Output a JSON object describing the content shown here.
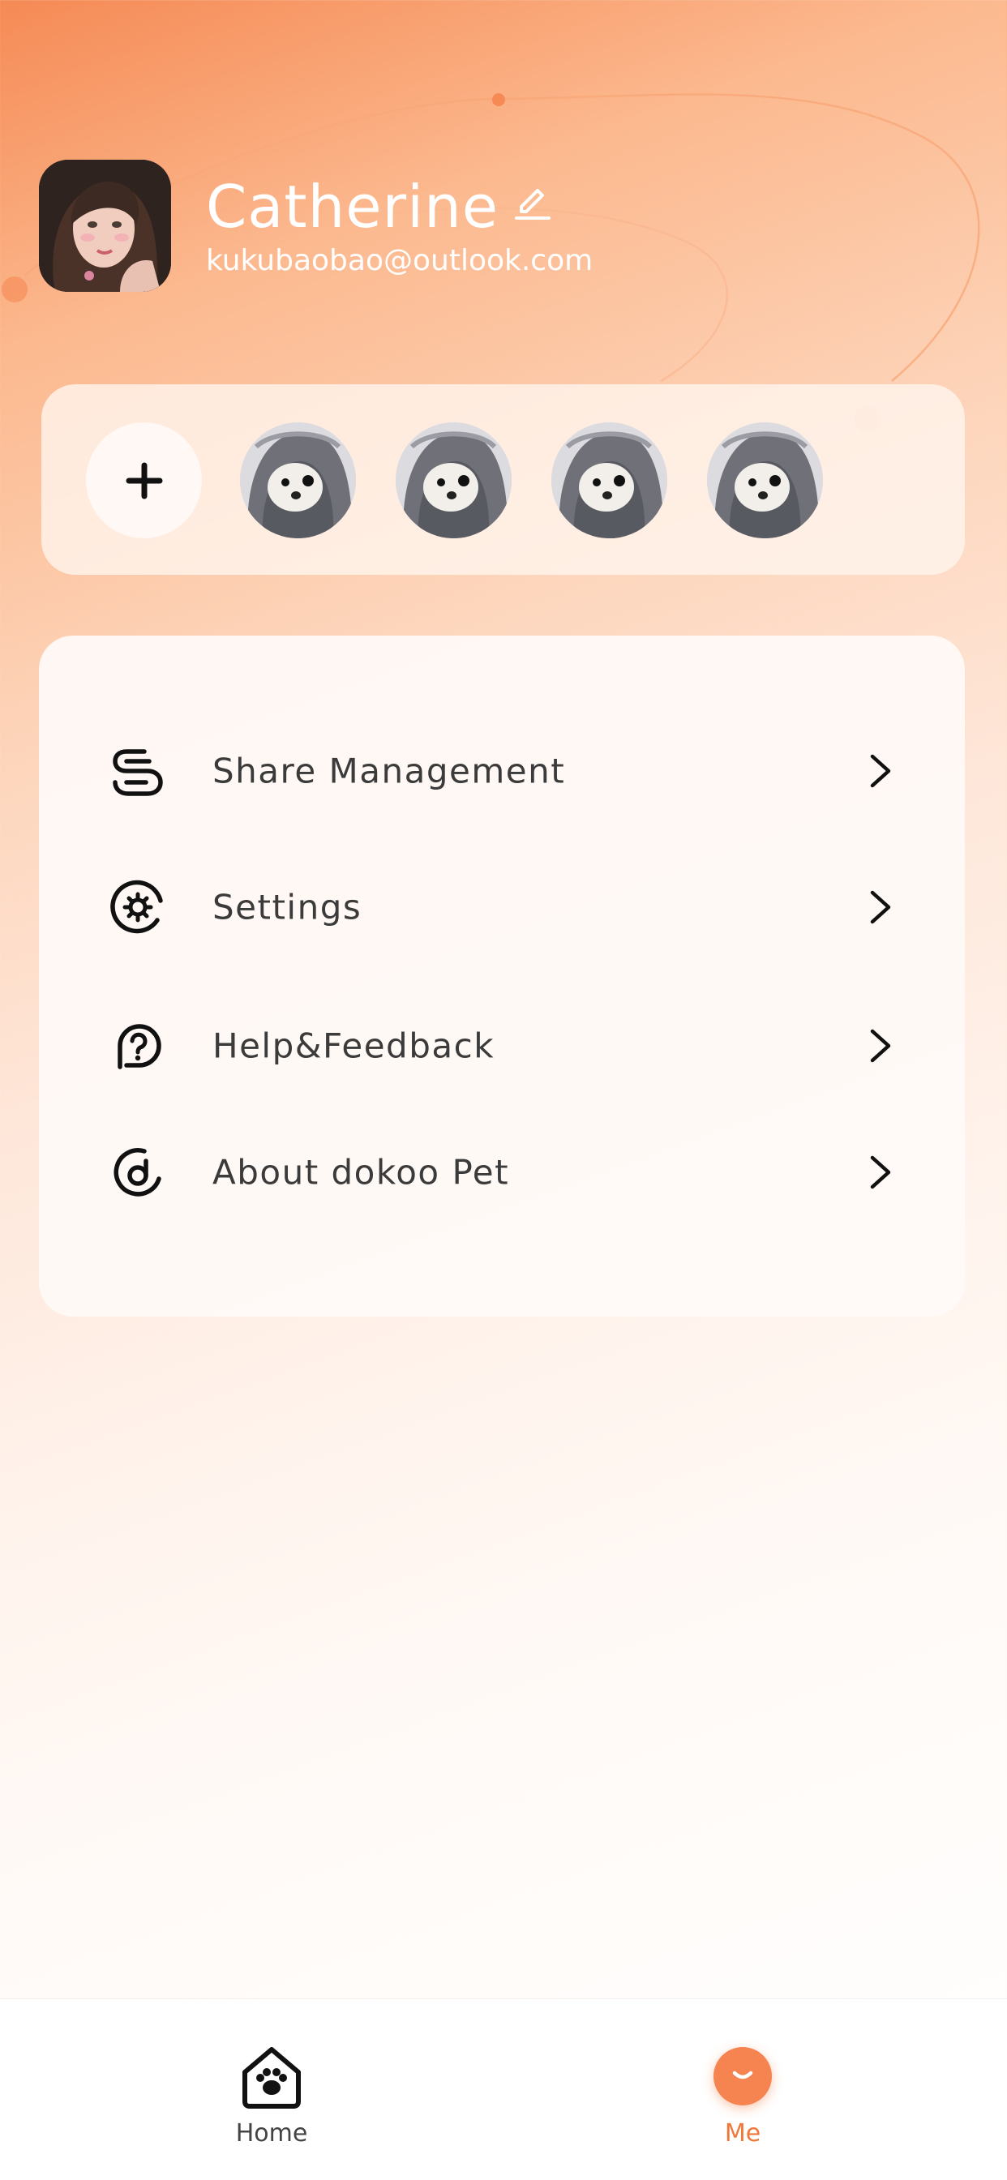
{
  "theme": {
    "accent": "#f58450",
    "accent_text": "#f0773a",
    "text_dark": "#3b3b3b"
  },
  "profile": {
    "name": "Catherine",
    "email": "kukubaobao@outlook.com",
    "avatar_icon": "user-avatar-photo",
    "edit_icon": "pencil-icon"
  },
  "pets": {
    "add_icon": "plus-icon",
    "items": [
      {
        "icon": "pet-avatar-photo"
      },
      {
        "icon": "pet-avatar-photo"
      },
      {
        "icon": "pet-avatar-photo"
      },
      {
        "icon": "pet-avatar-photo"
      }
    ]
  },
  "menu": {
    "items": [
      {
        "label": "Share Management",
        "icon": "share-management-icon"
      },
      {
        "label": "Settings",
        "icon": "settings-gear-icon"
      },
      {
        "label": "Help&Feedback",
        "icon": "help-question-icon"
      },
      {
        "label": "About dokoo Pet",
        "icon": "dokoo-logo-icon"
      }
    ],
    "chevron_icon": "chevron-right-icon"
  },
  "nav": {
    "items": [
      {
        "label": "Home",
        "icon": "home-paw-icon",
        "active": false
      },
      {
        "label": "Me",
        "icon": "smile-icon",
        "active": true
      }
    ]
  }
}
